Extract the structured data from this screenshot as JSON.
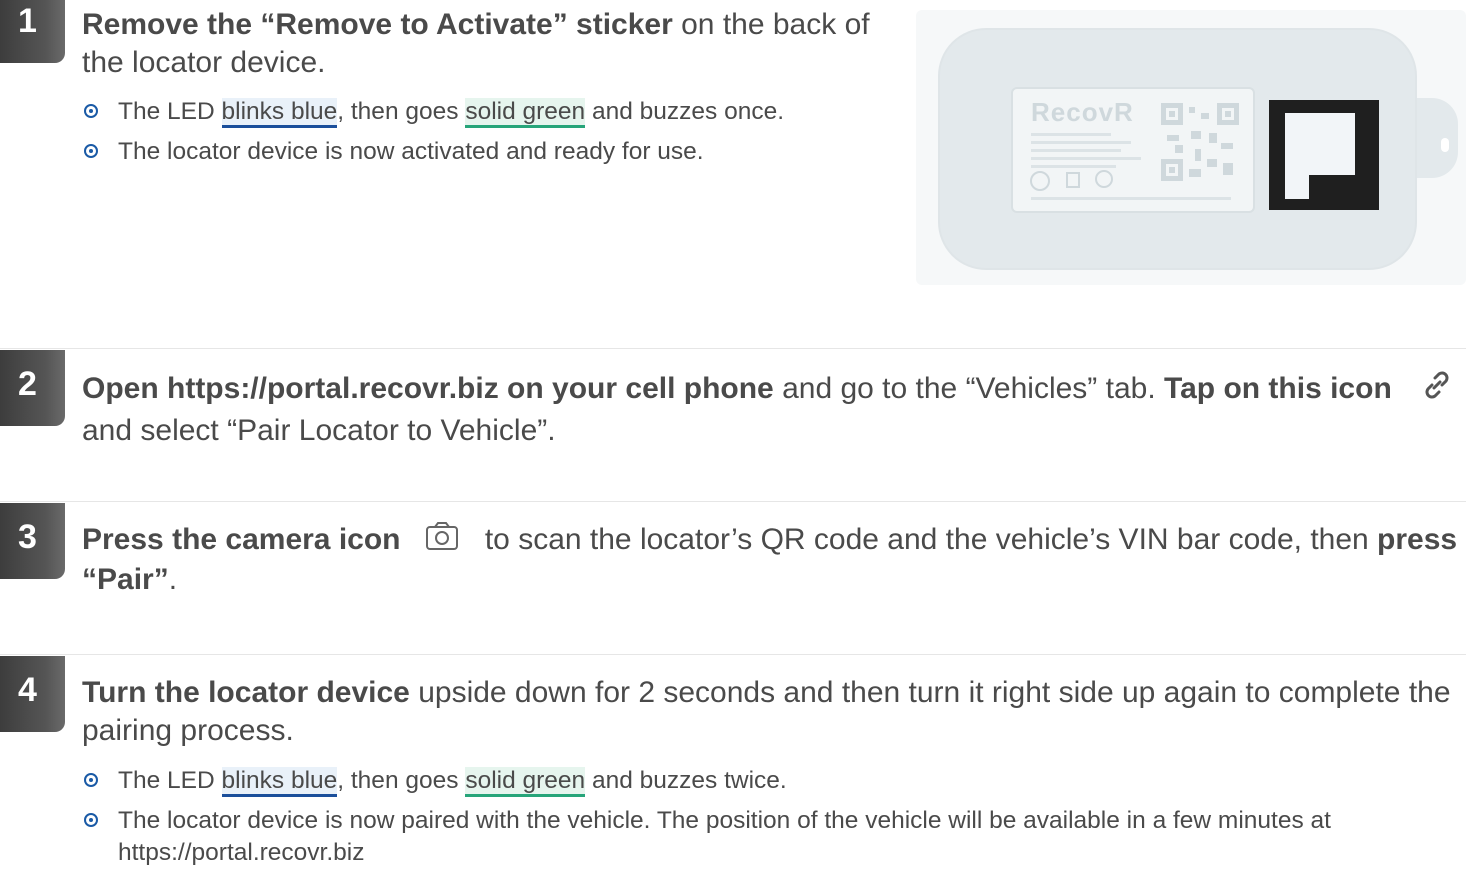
{
  "steps": [
    {
      "number": "1",
      "title": [
        {
          "text": "Remove the “Remove to Activate” sticker",
          "bold": true
        },
        {
          "text": " on the back of the locator device.",
          "bold": false
        }
      ],
      "bullets": [
        [
          {
            "text": "The LED "
          },
          {
            "text": "blinks blue",
            "hl": "blue"
          },
          {
            "text": ", then goes "
          },
          {
            "text": "solid green",
            "hl": "green"
          },
          {
            "text": " and buzzes once."
          }
        ],
        [
          {
            "text": "The locator device is now activated and ready for use."
          }
        ]
      ]
    },
    {
      "number": "2",
      "title": [
        {
          "text": "Open https://portal.recovr.biz on your cell phone",
          "bold": true
        },
        {
          "text": " and go to the  “Vehicles” tab. ",
          "bold": false
        },
        {
          "text": "Tap on this icon",
          "bold": true
        },
        {
          "icon": "link-icon"
        },
        {
          "text": " and select “Pair Locator to Vehicle”.",
          "bold": false
        }
      ]
    },
    {
      "number": "3",
      "title": [
        {
          "text": "Press the camera icon",
          "bold": true
        },
        {
          "icon": "camera-icon"
        },
        {
          "text": " to scan the locator’s QR code and the vehicle’s VIN bar code, then ",
          "bold": false
        },
        {
          "text": "press “Pair”",
          "bold": true
        },
        {
          "text": ".",
          "bold": false
        }
      ]
    },
    {
      "number": "4",
      "title": [
        {
          "text": "Turn the locator device",
          "bold": true
        },
        {
          "text": " upside down for 2 seconds and then turn it right side up again to complete the pairing process.",
          "bold": false
        }
      ],
      "bullets": [
        [
          {
            "text": "The LED "
          },
          {
            "text": "blinks blue",
            "hl": "blue"
          },
          {
            "text": ", then goes "
          },
          {
            "text": "solid green",
            "hl": "green"
          },
          {
            "text": " and buzzes twice."
          }
        ],
        [
          {
            "text": "The locator device is now paired with the vehicle. The position of the vehicle will be available in a few minutes at https://portal.recovr.biz"
          }
        ]
      ]
    }
  ],
  "device_image": {
    "brand": "RecovR"
  },
  "colors": {
    "badge": "#4a4a4a",
    "text": "#4a4a4a",
    "highlight_blue": "#1b4f9b",
    "highlight_green": "#27a57a",
    "bullet": "#1a5aa6"
  }
}
